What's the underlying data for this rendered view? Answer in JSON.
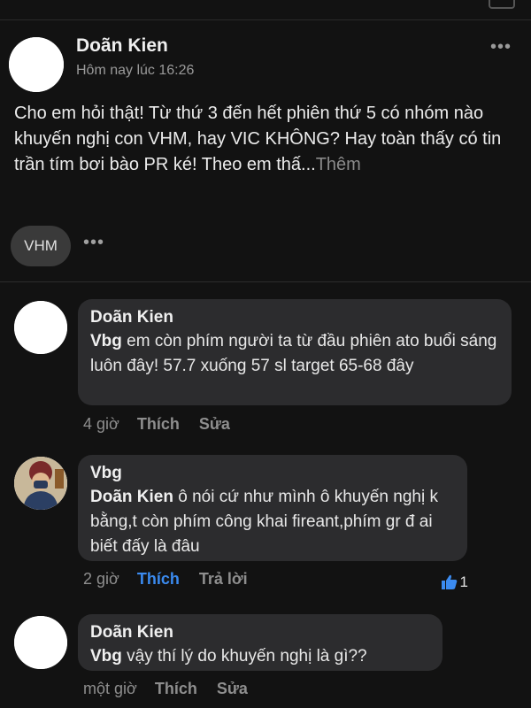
{
  "post": {
    "author": "Doãn Kien",
    "timestamp": "Hôm nay lúc 16:26",
    "body": "Cho em hỏi thật! Từ thứ 3 đến hết phiên thứ 5 có nhóm nào khuyến nghị con VHM, hay VIC KHÔNG? Hay toàn thấy có tin trần tím bơi bào PR ké! Theo em thấ...",
    "see_more": "Thêm",
    "more_menu": "•••",
    "tag": "VHM",
    "tag_more": "•••"
  },
  "comments": [
    {
      "author": "Doãn Kien",
      "mention": "Vbg",
      "text": " em còn phím người ta từ đầu phiên ato buổi sáng luôn đây! 57.7 xuống 57 sl target 65-68 đây",
      "time": "4 giờ",
      "like_label": "Thích",
      "second_action": "Sửa",
      "liked": false
    },
    {
      "author": "Vbg",
      "mention": "Doãn Kien",
      "text": "  ô nói cứ như mình ô khuyến nghị k bằng,t còn phím công khai fireant,phím gr đ ai biết đấy là đâu",
      "time": "2 giờ",
      "like_label": "Thích",
      "second_action": "Trả lời",
      "liked": true,
      "reaction_count": "1"
    },
    {
      "author": "Doãn Kien",
      "mention": "Vbg",
      "text": "  vậy thí lý do khuyến nghị là gì??",
      "time": "một giờ",
      "like_label": "Thích",
      "second_action": "Sửa",
      "liked": false
    }
  ],
  "colors": {
    "background": "#121212",
    "bubble": "#2c2c2e",
    "liked_blue": "#3b8bf0"
  }
}
